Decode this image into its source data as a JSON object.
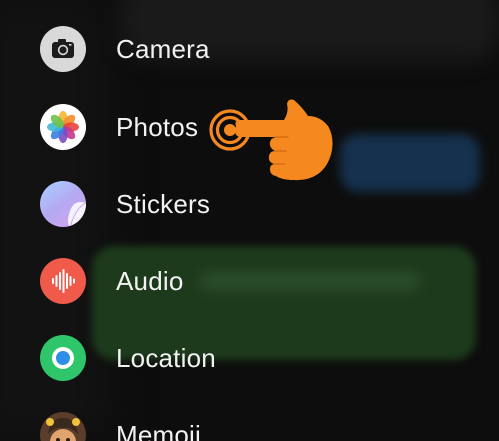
{
  "menu": {
    "items": [
      {
        "label": "Camera",
        "icon": "camera-icon"
      },
      {
        "label": "Photos",
        "icon": "photos-icon"
      },
      {
        "label": "Stickers",
        "icon": "stickers-icon"
      },
      {
        "label": "Audio",
        "icon": "audio-icon"
      },
      {
        "label": "Location",
        "icon": "location-icon"
      },
      {
        "label": "Memoji",
        "icon": "memoji-icon"
      }
    ]
  },
  "colors": {
    "label_text": "#f2f2f2",
    "pointer": "#f5891f",
    "audio_icon": "#f05a4b",
    "location_icon": "#2ec56b"
  },
  "pointer_icon": "tap-hand-icon"
}
